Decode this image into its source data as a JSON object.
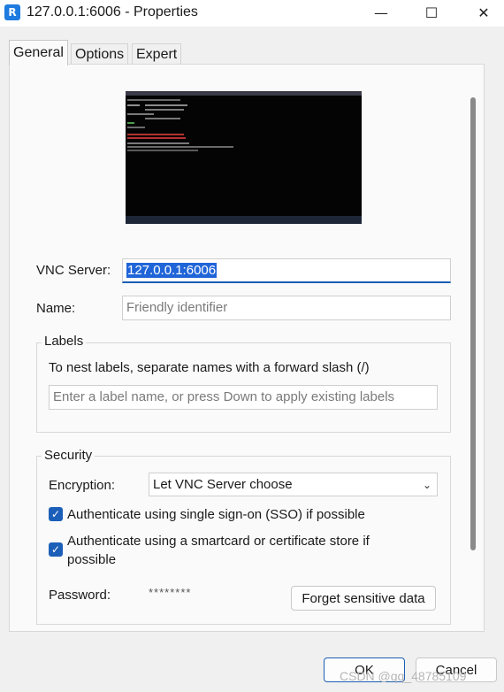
{
  "window": {
    "title": "127.0.0.1:6006 - Properties",
    "icon_letter": "R",
    "minimize_glyph": "—",
    "maximize_glyph": "☐",
    "close_glyph": "✕"
  },
  "tabs": [
    {
      "label": "General",
      "active": true
    },
    {
      "label": "Options",
      "active": false
    },
    {
      "label": "Expert",
      "active": false
    }
  ],
  "general": {
    "vnc_server_label": "VNC Server:",
    "vnc_server_value": "127.0.0.1:6006",
    "name_label": "Name:",
    "name_placeholder": "Friendly identifier"
  },
  "labels_group": {
    "title": "Labels",
    "hint": "To nest labels, separate names with a forward slash (/)",
    "input_placeholder": "Enter a label name, or press Down to apply existing labels"
  },
  "security_group": {
    "title": "Security",
    "encryption_label": "Encryption:",
    "encryption_value": "Let VNC Server choose",
    "sso_label": "Authenticate using single sign-on (SSO) if possible",
    "sso_checked": true,
    "smartcard_label_line1": "Authenticate using a smartcard or certificate store if",
    "smartcard_label_line2": "possible",
    "smartcard_checked": true,
    "password_label": "Password:",
    "password_value": "********",
    "forget_button": "Forget sensitive data"
  },
  "footer": {
    "ok_label": "OK",
    "cancel_label": "Cancel"
  },
  "watermark": "CSDN @qq_48785109",
  "colors": {
    "accent": "#1a5fb4",
    "checkbox": "#1c5fb8",
    "selection": "#2065d8"
  },
  "icons": {
    "app": "realvnc-viewer-icon",
    "checkbox": "checkmark-icon",
    "dropdown": "chevron-down-icon"
  }
}
